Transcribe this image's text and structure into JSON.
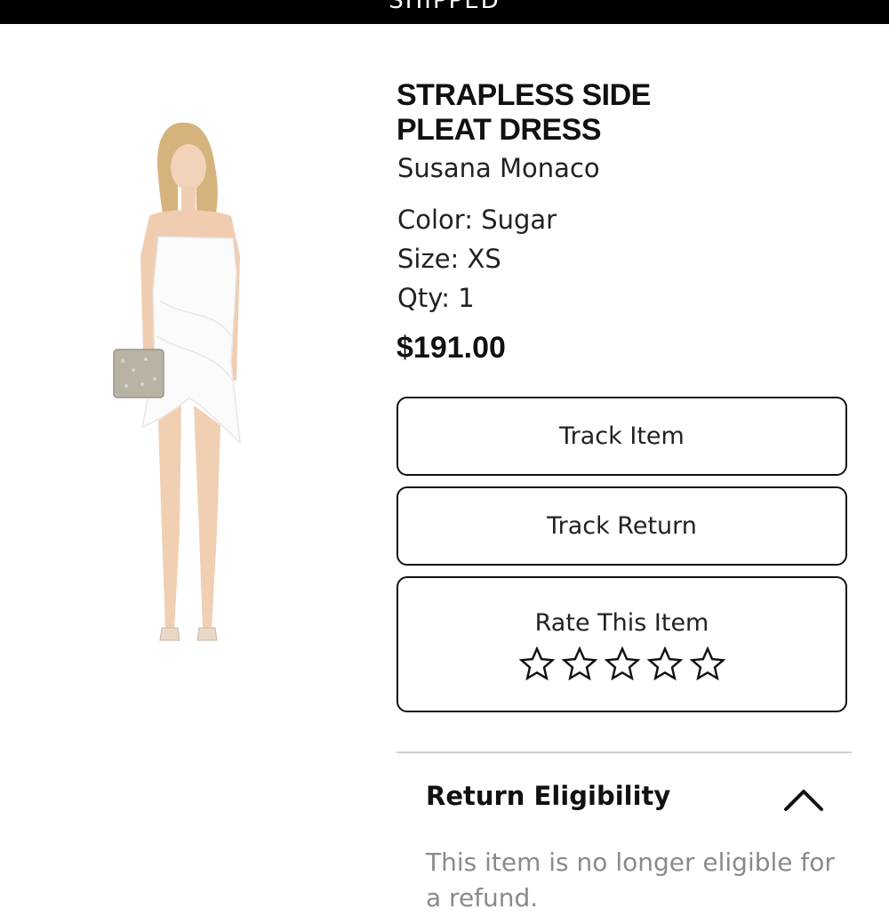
{
  "header": {
    "status_text": "SHIPPED"
  },
  "product": {
    "title_line1": "STRAPLESS SIDE",
    "title_line2": "PLEAT DRESS",
    "brand": "Susana Monaco",
    "color_line": "Color: Sugar",
    "size_line": "Size: XS",
    "qty_line": "Qty: 1",
    "price": "$191.00",
    "image_alt": "model wearing white strapless dress holding a sequined clutch"
  },
  "actions": {
    "track_item_label": "Track Item",
    "track_return_label": "Track Return",
    "rate_label": "Rate This Item",
    "rating": {
      "current": 0,
      "max": 5,
      "icon": "star-outline-icon"
    }
  },
  "return_eligibility": {
    "title": "Return Eligibility",
    "expanded": true,
    "toggle_icon": "chevron-up-icon",
    "message": "This item is no longer eligible for a refund."
  },
  "colors": {
    "header_bg": "#000000",
    "text_primary": "#111111",
    "text_muted": "#8a8a8a",
    "divider": "#cfcfcf"
  }
}
